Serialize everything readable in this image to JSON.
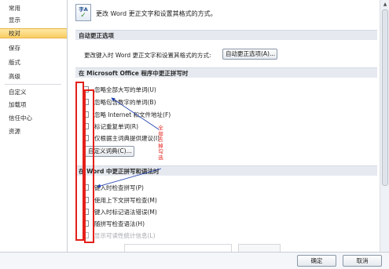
{
  "sidebar": {
    "items": [
      {
        "label": "常用"
      },
      {
        "label": "显示"
      },
      {
        "label": "校对"
      },
      {
        "label": "保存"
      },
      {
        "label": "版式"
      },
      {
        "label": "高级"
      },
      {
        "label": "自定义"
      },
      {
        "label": "加载项"
      },
      {
        "label": "信任中心"
      },
      {
        "label": "资源"
      }
    ],
    "active_index": 2
  },
  "header": {
    "icon_text": "字A",
    "icon": "proofing-abc-check-icon",
    "text": "更改 Word 更正文字和设置其格式的方式。"
  },
  "autocorrect": {
    "section_title": "自动更正选项",
    "description": "更改键入时 Word 更正文字和设置其格式的方式:",
    "button_label": "自动更正选项(A)..."
  },
  "office": {
    "section_title": "在 Microsoft Office 程序中更正拼写时",
    "checkboxes": [
      {
        "label": "忽略全部大写的单词(U)",
        "checked": false
      },
      {
        "label": "忽略包含数字的单词(B)",
        "checked": false
      },
      {
        "label": "忽略 Internet 和文件地址(F)",
        "checked": false
      },
      {
        "label": "标记重复单词(R)",
        "checked": false
      },
      {
        "label": "仅根据主词典提供建议(I)",
        "checked": false
      }
    ],
    "dict_button_label": "自定义词典(C)..."
  },
  "word": {
    "section_title": "在 Word 中更正拼写和语法时",
    "checkboxes": [
      {
        "label": "键入时检查拼写(P)",
        "checked": false,
        "disabled": false
      },
      {
        "label": "使用上下文拼写检查(M)",
        "checked": false,
        "disabled": false
      },
      {
        "label": "键入时标记语法错误(M)",
        "checked": false,
        "disabled": false
      },
      {
        "label": "随拼写检查语法(H)",
        "checked": false,
        "disabled": false
      },
      {
        "label": "显示可读性统计信息(L)",
        "checked": false,
        "disabled": true
      }
    ]
  },
  "annotation_text": "全部去掉勾选",
  "footer": {
    "ok_label": "确定",
    "cancel_label": "取消"
  },
  "colors": {
    "highlight": "#f9cd62",
    "annotation_red": "#e4201a",
    "section_bg": "#e6eaf0"
  }
}
